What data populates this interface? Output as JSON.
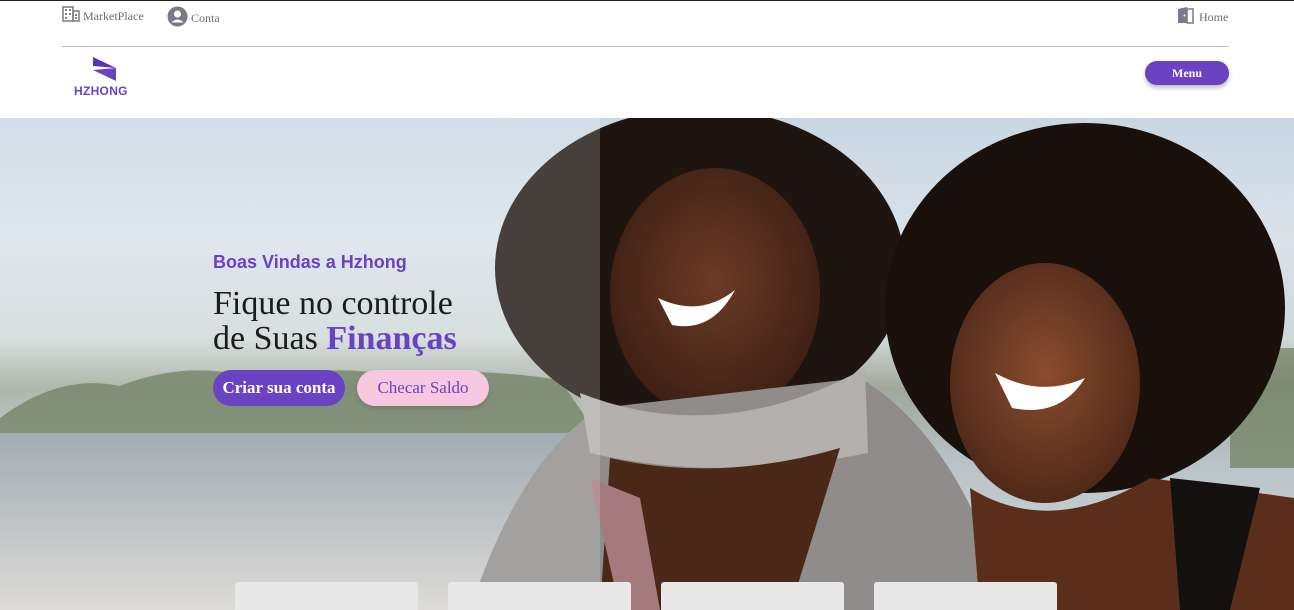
{
  "topbar": {
    "marketplace_label": "MarketPlace",
    "conta_label": "Conta",
    "home_label": "Home"
  },
  "brand": {
    "logo_text": "HZHONG",
    "accent": "#6a42c2",
    "pink": "#f7c8e0"
  },
  "nav": {
    "menu_label": "Menu"
  },
  "hero": {
    "kicker": "Boas Vindas a Hzhong",
    "title_line1": "Fique no controle",
    "title_line2_prefix": "de Suas ",
    "title_line2_accent": "Finanças",
    "primary_cta": "Criar sua conta",
    "secondary_cta": "Checar Saldo"
  },
  "icons": {
    "marketplace": "building-icon",
    "conta": "account-circle-icon",
    "home": "door-icon"
  }
}
